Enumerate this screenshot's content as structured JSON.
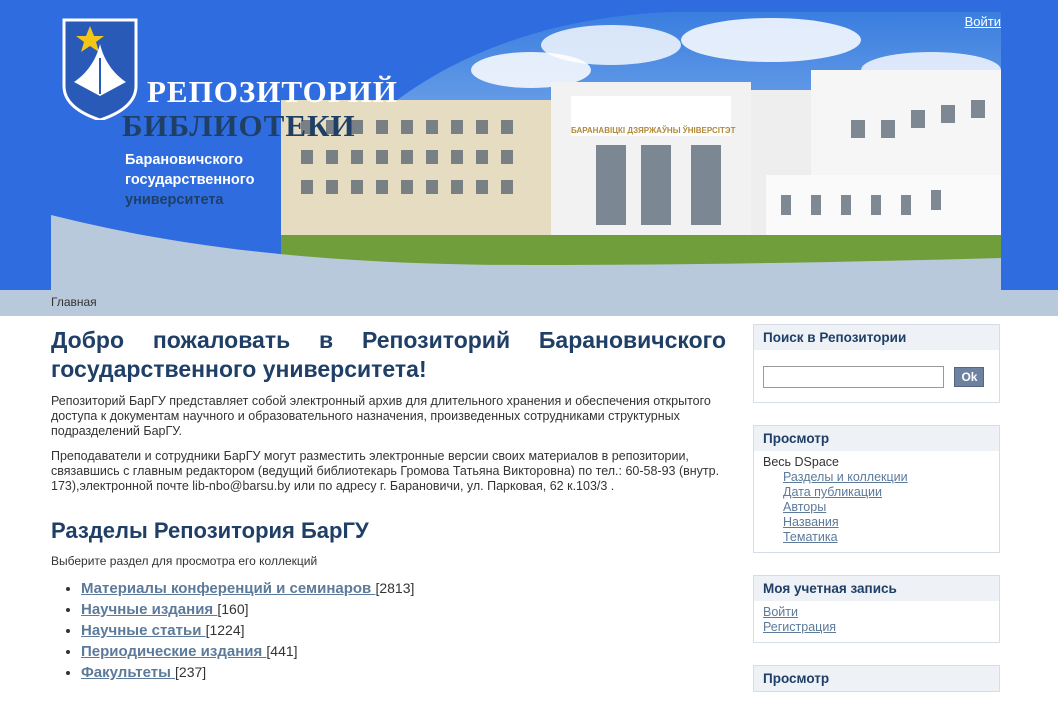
{
  "header": {
    "logo_title_line1": "РЕПОЗИТОРИЙ",
    "logo_title_line2": "БИБЛИОТЕКИ",
    "logo_subtitle_line1": "Барановичского",
    "logo_subtitle_line2": "государственного",
    "logo_subtitle_line3": "университета",
    "building_sign": "БАРАНАВІЦКІ ДЗЯРЖАЎНЫ ЎНІВЕРСІТЭТ",
    "login_link": "Войти"
  },
  "breadcrumb": {
    "home": "Главная"
  },
  "main": {
    "title": "Добро пожаловать в Репозиторий Барановичского государственного университета!",
    "para1": "Репозиторий БарГУ представляет собой электронный архив для длительного хранения и обеспечения открытого доступа к документам научного и образовательного назначения, произведенных сотрудниками структурных подразделений БарГУ.",
    "para2": "Преподаватели и сотрудники БарГУ могут разместить электронные версии своих материалов в репозитории, связавшись с главным редактором (ведущий библиотекарь Громова Татьяна Викторовна) по тел.: 60-58-93 (внутр. 173),электронной почте lib-nbo@barsu.by или по адресу г. Барановичи, ул. Парковая, 62 к.103/3 .",
    "sections_title": "Разделы Репозитория БарГУ",
    "sections_hint": "Выберите раздел для просмотра его коллекций",
    "sections": [
      {
        "label": "Материалы конференций и семинаров ",
        "count": "[2813]"
      },
      {
        "label": "Научные издания ",
        "count": "[160]"
      },
      {
        "label": "Научные статьи ",
        "count": "[1224]"
      },
      {
        "label": "Периодические издания ",
        "count": "[441]"
      },
      {
        "label": "Факультеты ",
        "count": "[237]"
      }
    ]
  },
  "sidebar": {
    "search": {
      "title": "Поиск в Репозитории",
      "button": "Ok",
      "value": ""
    },
    "browse": {
      "title": "Просмотр",
      "scope": "Весь DSpace",
      "links": [
        "Разделы и коллекции",
        "Дата публикации",
        "Авторы",
        "Названия",
        "Тематика"
      ]
    },
    "account": {
      "title": "Моя учетная запись",
      "links": [
        "Войти",
        "Регистрация"
      ]
    },
    "browse2": {
      "title": "Просмотр"
    }
  },
  "colors": {
    "header_blue": "#2f6ce0",
    "nav_bar": "#b9c9dc",
    "title_blue": "#1f3f66",
    "link": "#5c7a9a"
  }
}
